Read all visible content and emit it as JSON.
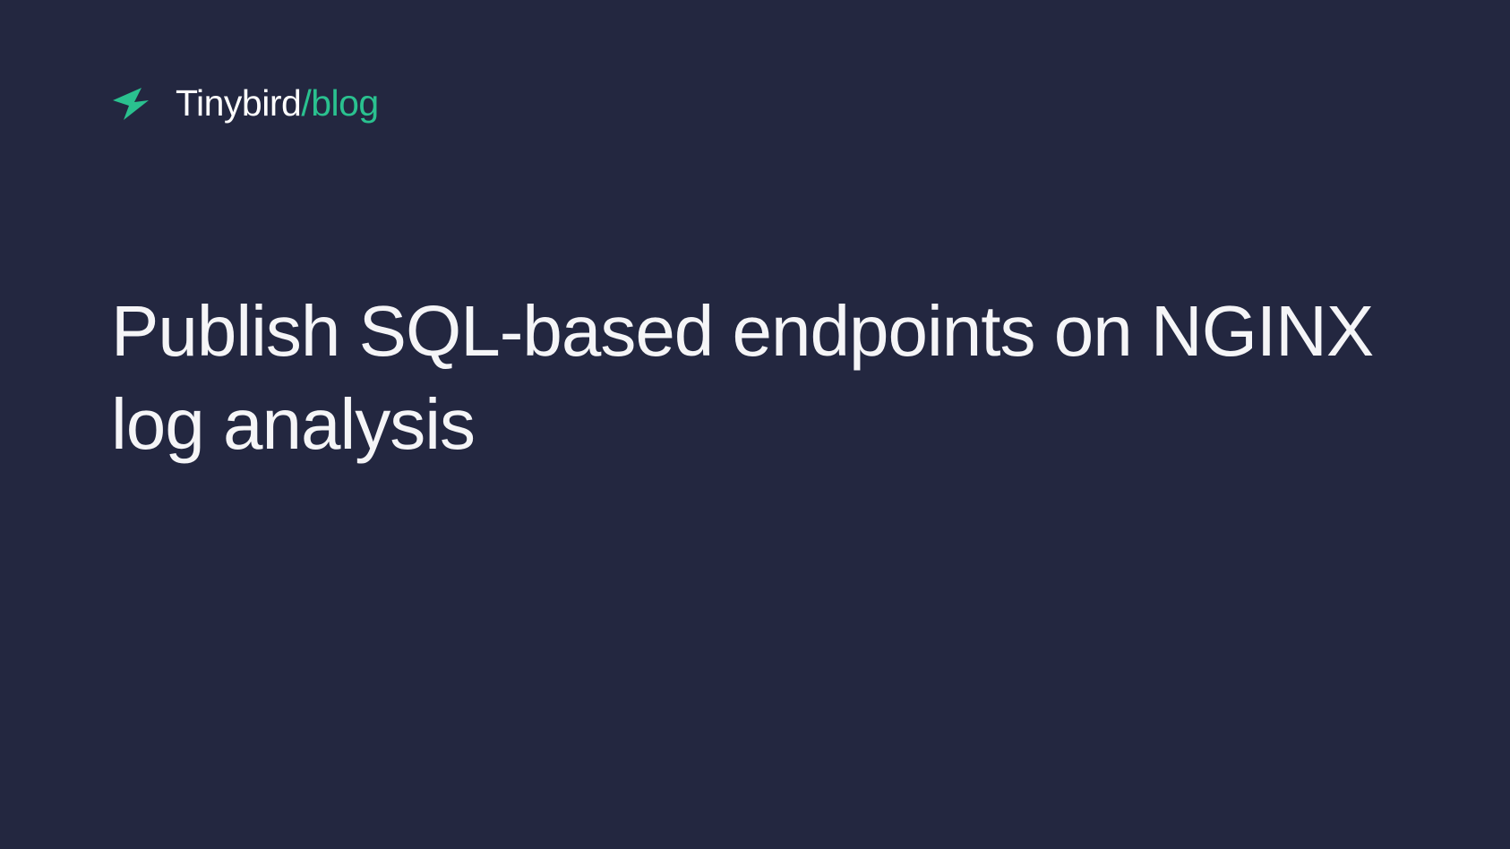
{
  "header": {
    "brand_name": "Tinybird",
    "separator": "/",
    "section": "blog",
    "logo_color": "#2ac18f"
  },
  "content": {
    "title": "Publish SQL-based endpoints on NGINX log analysis"
  }
}
